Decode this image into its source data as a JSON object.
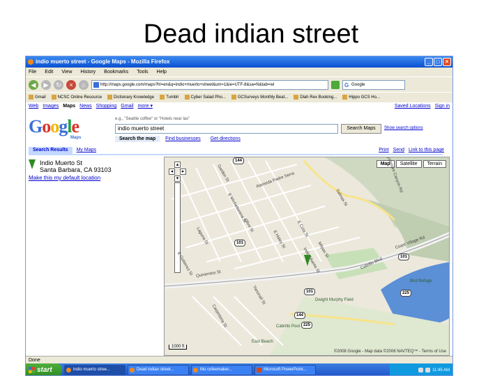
{
  "slide": {
    "title": "Dead indian street"
  },
  "window": {
    "title": "indio muerto street - Google Maps - Mozilla Firefox"
  },
  "menu": [
    "File",
    "Edit",
    "View",
    "History",
    "Bookmarks",
    "Tools",
    "Help"
  ],
  "nav": {
    "url": "http://maps.google.com/maps?hl=en&q=indio+muerto+street&um=1&ie=UTF-8&sa=N&tab=wl",
    "search_engine": "Google"
  },
  "bookmarks": [
    "Gmail",
    "NCSC Online Resource",
    "Dictionary Knowledge",
    "Tumblr",
    "Cyber Salad Pho...",
    "GCSurveys Monthly Beat...",
    "Dlah Rex Booking...",
    "Hippo GCS Ho..."
  ],
  "google": {
    "nav": [
      "Web",
      "Images",
      "Maps",
      "News",
      "Shopping",
      "Gmail",
      "more ▾"
    ],
    "nav_active": "Maps",
    "nav_right": [
      "Saved Locations",
      "Sign in"
    ],
    "logo_sub": "Maps",
    "search_hint": "e.g., \"Seattle coffee\" or \"Hotels near lax\"",
    "search_value": "indio muerto street",
    "search_button": "Search Maps",
    "show_options": "Show search options",
    "tabs": [
      "Search the map",
      "Find businesses",
      "Get directions"
    ],
    "panel_tabs": [
      "Search Results",
      "My Maps"
    ],
    "panel_tools": [
      "Print",
      "Send",
      "Link to this page"
    ]
  },
  "result": {
    "name": "Indio Muerto St",
    "address": "Santa Barbara, CA 93103",
    "default_link": "Make this my default location"
  },
  "map": {
    "types": [
      "Map",
      "Satellite",
      "Terrain"
    ],
    "active_type": "Map",
    "scale": "1000 ft",
    "copyright": "©2008 Google - Map data ©2008 NAVTEQ™ - Terms of Use",
    "streets": [
      "Alameda Padre Serra",
      "Garden St",
      "E Micheltorena St",
      "Olive St",
      "Laguna St",
      "E Haley St",
      "E Cota St",
      "Salinas St",
      "Indio Muerto St",
      "Milpas St",
      "Quinientos St",
      "E Gutierrez St",
      "Carpinteria St",
      "Yanonali St",
      "Cabrillo Blvd",
      "Coast Village Rd",
      "Sycamore Canyon Rd"
    ],
    "highways": [
      "144",
      "101",
      "101",
      "225",
      "144",
      "225"
    ],
    "pois": [
      "East Beach",
      "Dwight Murphy Field",
      "Cabrillo Pool",
      "Bird Refuge"
    ]
  },
  "status": "Done",
  "taskbar": {
    "start": "start",
    "tasks": [
      "indio muerto stree...",
      "Dead indian street...",
      "Mu cofeemaker...",
      "Microsoft PowerPoint..."
    ],
    "time": "11:45 AM"
  }
}
